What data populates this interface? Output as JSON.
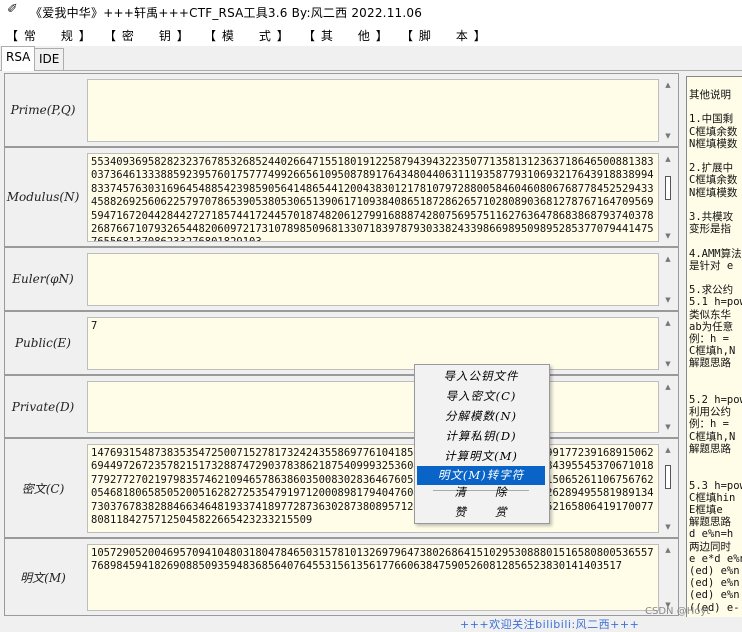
{
  "window": {
    "title": "《爱我中华》+++轩禹+++CTF_RSA工具3.6    By:风二西 2022.11.06"
  },
  "menu": [
    "【 常     规 】",
    "【 密     钥 】",
    "【 模     式 】",
    "【 其     他 】",
    "【 脚     本 】"
  ],
  "tabs": [
    "RSA",
    "IDE"
  ],
  "fields": [
    {
      "label": "Prime(P,Q)",
      "value": ""
    },
    {
      "label": "Modulus(N)",
      "value": "553409369582823237678532685244026647155180191225879439432235077135813123637186465008813830373646133388592395760175777499266561095087891764348044063111935877931069321764391883899483374576303169645488542398590564148654412004383012178107972880058460460806768778452529433458826925606225797078653905380530651390617109384086518728626571028089036812787671647095695947167204428442727185744172445701874820612799168887428075695751162763647868386879374037826876671079326544820609721731078985096813307183978793033824339866989509895285377079441475765568137086233276801829103"
    },
    {
      "label": "Euler(φN)",
      "value": ""
    },
    {
      "label": "Public(E)",
      "value": "7"
    },
    {
      "label": "Private(D)",
      "value": ""
    },
    {
      "label": "密文(C)",
      "value": "147693154873835354725007152781732424355869776104185743266791772367236626991772391689150626944972672357821517328874729037838621875409993253604717327650632167150338439554537067101877927727021979835746210946578638603500830283646760509495458715723282952515065261106756762054681806585052005162827253547919712000898179404760445193750864902285376262894955819891347303767838288466346481933741897728736302873808957124505485242331701209645216580641917007780811842757125045822665423233215509"
    },
    {
      "label": "明文(M)",
      "value": "10572905200469570941048031804784650315781013269796473802686415102953088801516580800536557768984594182690885093594836856407645531561356177660638475905260812856523830141403517"
    }
  ],
  "context_menu": {
    "items": [
      "导入公钥文件",
      "导入密文(C)",
      "分解模数(N)",
      "计算私钥(D)",
      "计算明文(M)",
      "明文(M)转字符"
    ],
    "extra": [
      "清      除",
      "赞      赏"
    ],
    "selected_index": 5
  },
  "notes": {
    "lines": [
      "其他说明",
      "",
      "1.中国剩",
      "C框填余数",
      "N框填模数",
      "",
      "2.扩展中",
      "C框填余数",
      "N框填模数",
      "",
      "3.共模攻",
      "变形是指",
      "",
      "4.AMM算法",
      "是针对 e",
      "",
      "5.求公约",
      "5.1 h=pow",
      "类似东华",
      "ab为任意",
      "例：h = ",
      "C框填h,N",
      "解题思路",
      "",
      "",
      "5.2 h=pow",
      "利用公约",
      "例：h = ",
      "C框填h,N",
      "解题思路",
      "",
      "",
      "5.3 h=pow",
      "C框填hin",
      "E框填e",
      "解题思路",
      "d e%n=h",
      "两边同时",
      "e e*d e%n",
      "(ed) e%n",
      "(ed) e%n",
      "(ed) e%n",
      "((ed) e-"
    ]
  },
  "footer": {
    "text": "+++欢迎关注bilibili:风二西+++"
  },
  "watermark": {
    "text": "CSDN @Hoyt"
  }
}
